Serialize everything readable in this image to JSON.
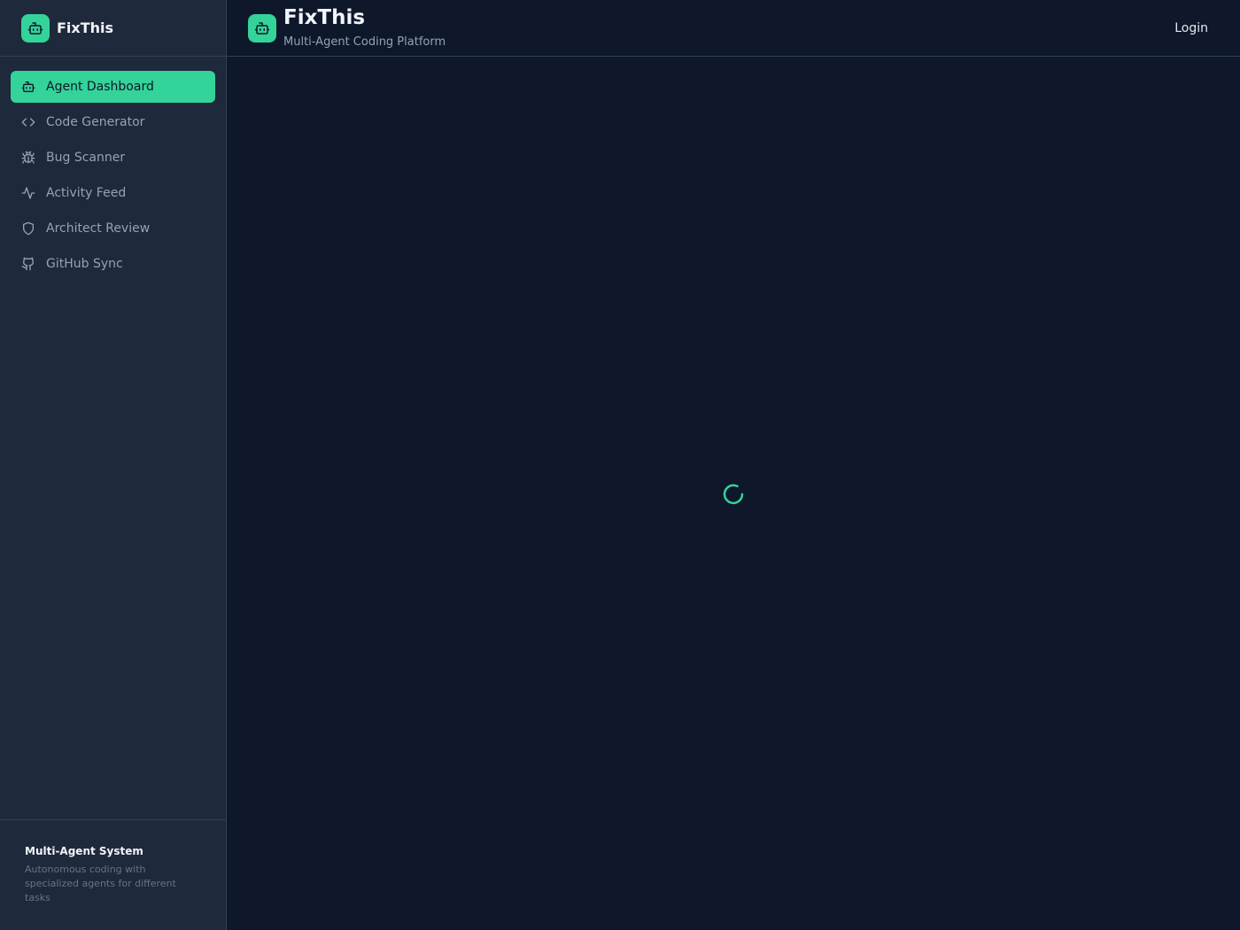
{
  "sidebar": {
    "brand": "FixThis",
    "nav": [
      {
        "label": "Agent Dashboard",
        "icon": "bot-icon",
        "active": true
      },
      {
        "label": "Code Generator",
        "icon": "code-icon",
        "active": false
      },
      {
        "label": "Bug Scanner",
        "icon": "bug-icon",
        "active": false
      },
      {
        "label": "Activity Feed",
        "icon": "activity-icon",
        "active": false
      },
      {
        "label": "Architect Review",
        "icon": "shield-icon",
        "active": false
      },
      {
        "label": "GitHub Sync",
        "icon": "github-icon",
        "active": false
      }
    ],
    "footer": {
      "title": "Multi-Agent System",
      "text": "Autonomous coding with specialized agents for different tasks"
    }
  },
  "header": {
    "title": "FixThis",
    "subtitle": "Multi-Agent Coding Platform",
    "login_label": "Login"
  },
  "main": {
    "loading_icon": "spinner-icon"
  },
  "colors": {
    "accent": "#34d399",
    "background": "#0f172a",
    "sidebar": "#1e293b",
    "border": "#334155",
    "muted_text": "#94a3b8"
  }
}
